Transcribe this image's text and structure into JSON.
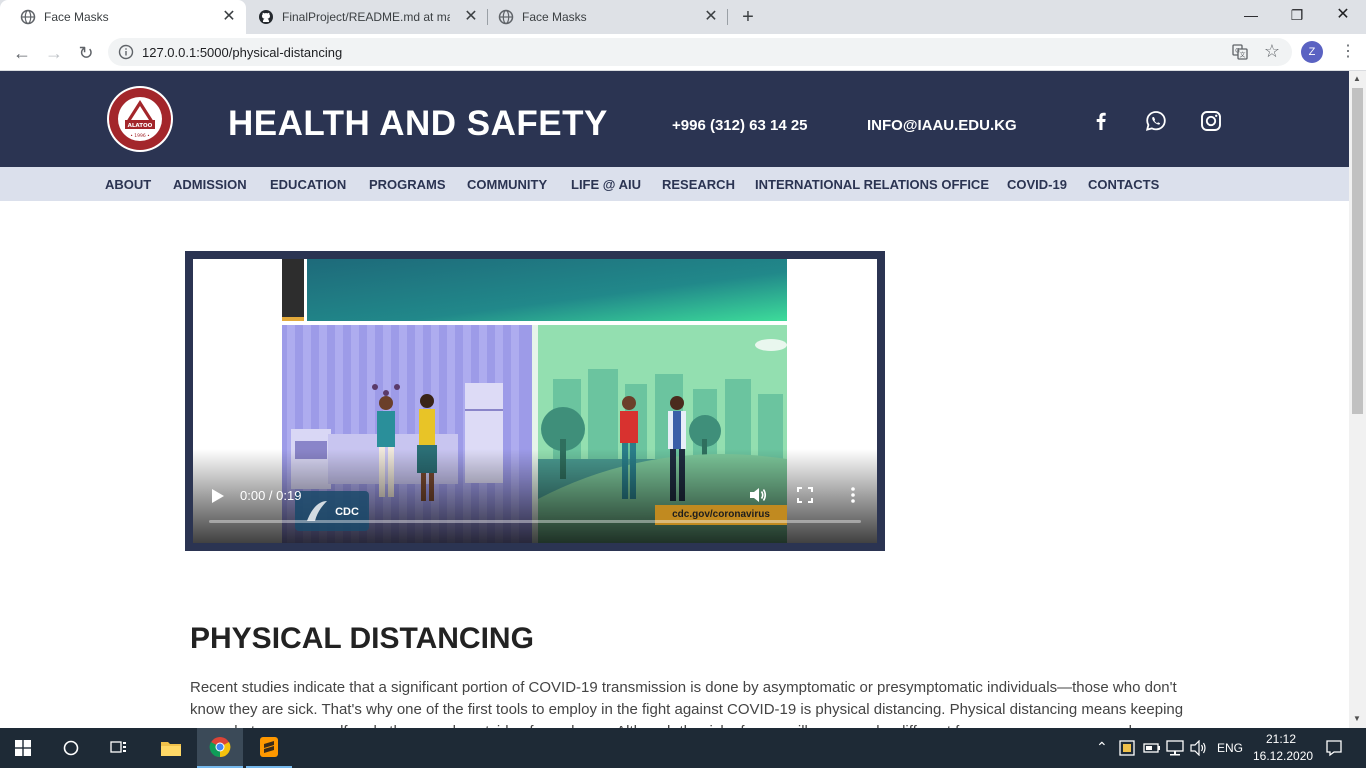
{
  "browser": {
    "tabs": [
      {
        "title": "Face Masks",
        "active": true
      },
      {
        "title": "FinalProject/README.md at main",
        "active": false
      },
      {
        "title": "Face Masks",
        "active": false
      }
    ],
    "url": "127.0.0.1:5000/physical-distancing",
    "profile_initial": "Z",
    "new_tab_label": "+"
  },
  "site": {
    "title": "HEALTH AND SAFETY",
    "phone": "+996 (312) 63 14 25",
    "email": "INFO@IAAU.EDU.KG",
    "logo_text": "ATATÜRK ALATOO",
    "logo_year": "1996",
    "nav": [
      "ABOUT",
      "ADMISSION",
      "EDUCATION",
      "PROGRAMS",
      "COMMUNITY",
      "LIFE @ AIU",
      "RESEARCH",
      "INTERNATIONAL RELATIONS OFFICE",
      "COVID-19",
      "CONTACTS"
    ],
    "social_icons": [
      "facebook-icon",
      "whatsapp-icon",
      "instagram-icon"
    ]
  },
  "video": {
    "time": "0:00 / 0:19",
    "progress": 0.0,
    "cdc_logo": "CDC",
    "cdc_url": "cdc.gov/coronavirus"
  },
  "article": {
    "title": "PHYSICAL DISTANCING",
    "body": "Recent studies indicate that a significant portion of COVID-19 transmission is done by asymptomatic or presymptomatic individuals—those who don't know they are sick. That's why one of the first tools to employ in the fight against COVID-19 is physical distancing. Physical distancing means keeping space between yourself and other people outside of your home. Although the risk of severe illness may be different for everyone, anyone can become"
  },
  "taskbar": {
    "language": "ENG",
    "time": "21:12",
    "date": "16.12.2020"
  },
  "colors": {
    "header_bg": "#2b3452",
    "nav_bg": "#dbe0ec",
    "accent": "#2b3452"
  }
}
